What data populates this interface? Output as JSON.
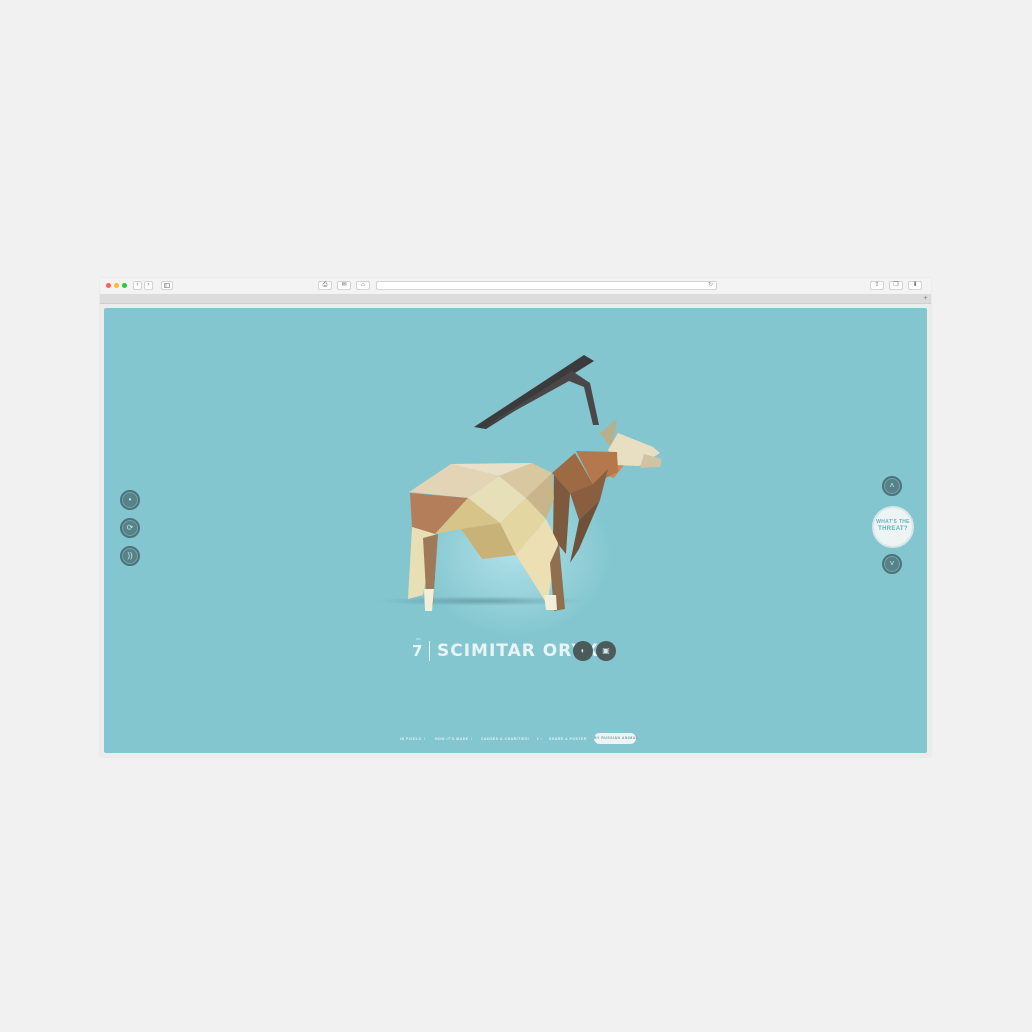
{
  "browser": {
    "toolbar": {
      "back_label": "‹",
      "forward_label": "›",
      "print_label": "⎙",
      "mail_label": "✉",
      "home_label": "⌂",
      "reload_label": "↻",
      "share_label": "⇪",
      "tabs_label": "❐",
      "download_label": "⬇"
    },
    "tabbar": {
      "new_tab_label": "+"
    }
  },
  "page": {
    "number_small": "NO.",
    "number": "7",
    "species": "SCIMITAR ORYX",
    "threat_line1": "WHAT'S THE",
    "threat_line2": "THREAT?",
    "side_controls": {
      "dot": "•",
      "share": "⟳",
      "sound": "))"
    },
    "nav": {
      "up": "˄",
      "down": "˅"
    },
    "action_icons": {
      "left": "◐",
      "right": "▣"
    },
    "footer": {
      "items": [
        "IN PIXELS",
        "HOW IT'S MADE",
        "CAUSES & CHARITIES",
        "SHARE A POSTER"
      ],
      "social": "f ✓",
      "cta": "BY RUSSIAN ANIMAL"
    }
  },
  "colors": {
    "background": "#83c6cf",
    "dark_button": "#4c5a5c",
    "threat_text": "#5fb4be"
  }
}
